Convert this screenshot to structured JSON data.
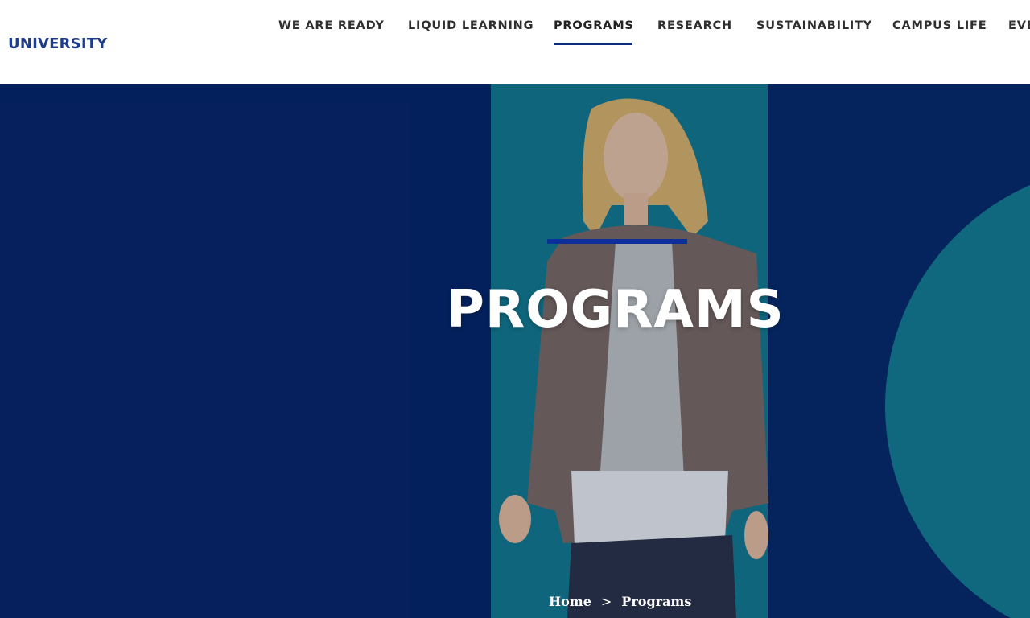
{
  "header": {
    "logo_text": "UNIVERSITY",
    "nav": [
      {
        "label": "WE ARE READY",
        "active": false
      },
      {
        "label": "LIQUID LEARNING",
        "active": false
      },
      {
        "label": "PROGRAMS",
        "active": true
      },
      {
        "label": "RESEARCH",
        "active": false
      },
      {
        "label": "SUSTAINABILITY",
        "active": false
      },
      {
        "label": "CAMPUS LIFE",
        "active": false
      },
      {
        "label": "EVE",
        "active": false
      }
    ]
  },
  "hero": {
    "title": "PROGRAMS",
    "breadcrumb": {
      "home": "Home",
      "separator": ">",
      "current": "Programs"
    }
  },
  "colors": {
    "brand_blue": "#1d3b8f",
    "hero_navy": "#04205f",
    "hero_teal": "#137a8e",
    "accent_bar": "#0d2f9a"
  }
}
